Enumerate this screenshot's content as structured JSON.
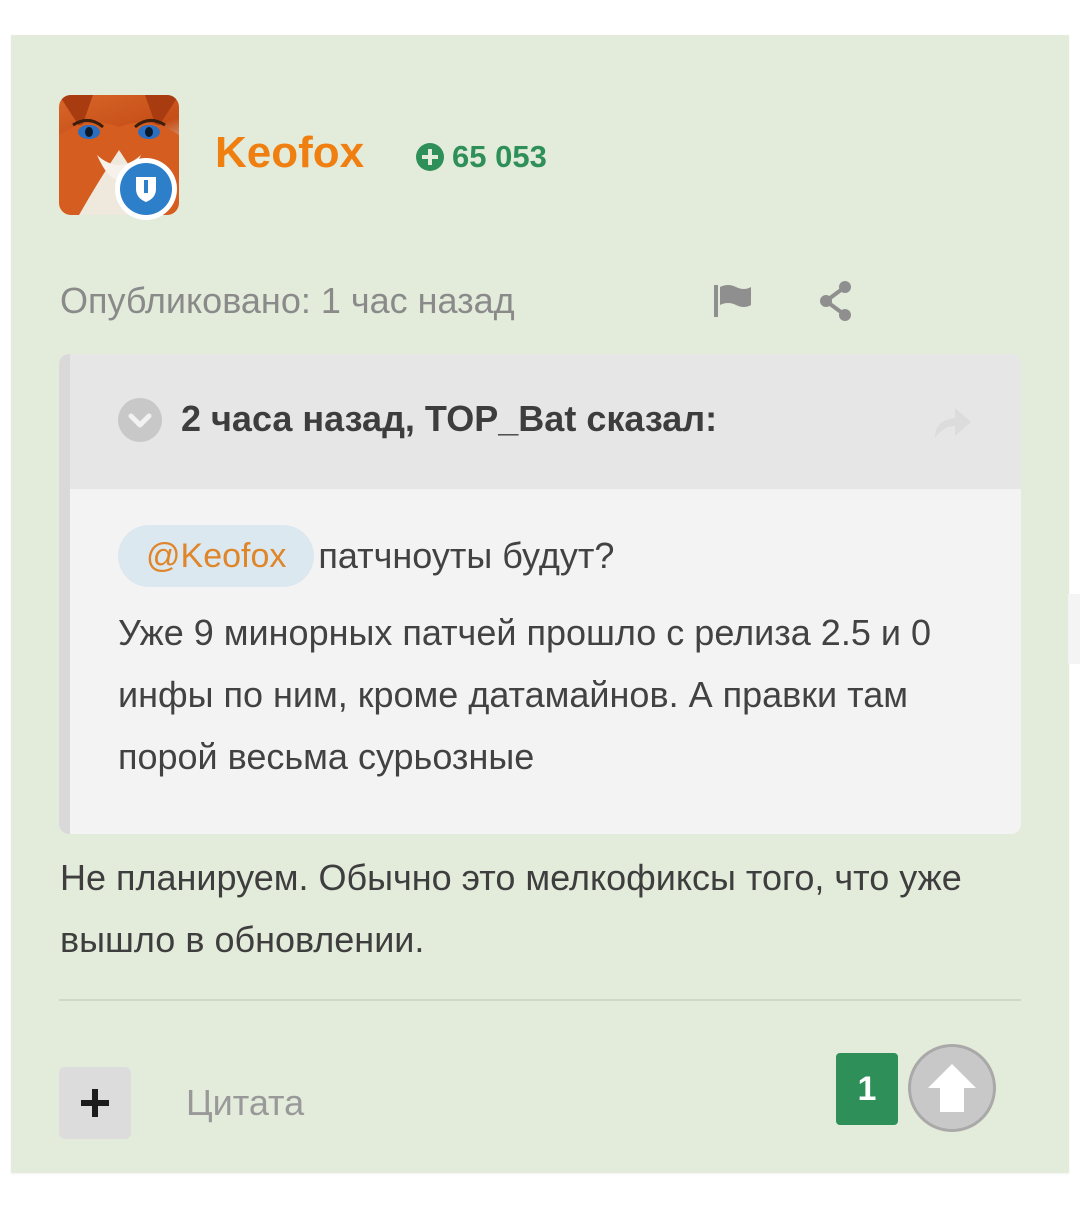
{
  "author": {
    "name": "Keofox",
    "reputation": "65 053"
  },
  "post": {
    "published": "Опубликовано: 1 час назад",
    "quote": {
      "citation": "2 часа назад, TOP_Bat сказал:",
      "mention": "@Keofox",
      "line1": "патчноуты будут?",
      "paragraph": "Уже 9 минорных патчей прошло с релиза 2.5 и 0 инфы по ним, кроме датамайнов. А правки там порой весьма сурьозные"
    },
    "reply": "Не планируем. Обычно это мелкофиксы того, что уже вышло в обновлении."
  },
  "actions": {
    "quote_label": "Цитата",
    "score": "1"
  },
  "colors": {
    "card_bg": "#e3ecdb",
    "author_name": "#f07f12",
    "reputation": "#2e8f59",
    "score_badge": "#2e8f59",
    "mention_bg": "#dce8f0",
    "mention_text": "#e0862a"
  },
  "icons": {
    "avatar": "fox-avatar",
    "staff": "shield-badge-icon",
    "reputation": "plus-circle-icon",
    "report": "flag-icon",
    "share": "share-icon",
    "collapse": "chevron-down-icon",
    "goto": "reply-arrow-icon",
    "multiquote": "plus-icon",
    "upvote": "arrow-up-icon"
  }
}
